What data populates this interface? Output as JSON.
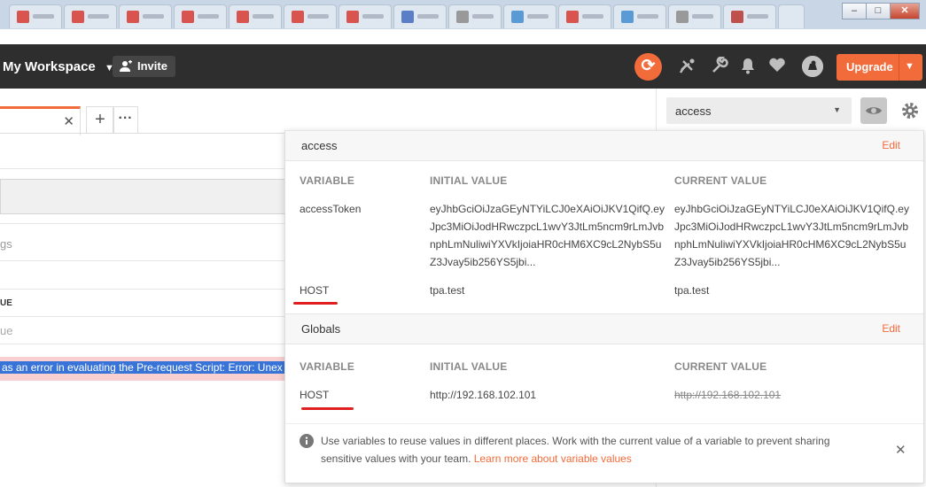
{
  "app": {
    "workspace_label": "My Workspace",
    "invite_label": "Invite",
    "upgrade_label": "Upgrade"
  },
  "environment": {
    "selected": "access"
  },
  "request": {
    "error_text": "as an error in evaluating the Pre-request Script:  Error: Unex",
    "fragment_settings": "gs",
    "fragment_value_header": "UE",
    "fragment_value_placeholder": "ue"
  },
  "popover": {
    "environment_section": {
      "title": "access",
      "edit_label": "Edit",
      "columns": [
        "VARIABLE",
        "INITIAL VALUE",
        "CURRENT VALUE"
      ],
      "rows": [
        {
          "variable": "accessToken",
          "initial": "eyJhbGciOiJzaGEyNTYiLCJ0eXAiOiJKV1QifQ.eyJpc3MiOiJodHRwczpcL1wvY3JtLm5ncm9rLmJvbnphLmNuliwiYXVkIjoiaHR0cHM6XC9cL2NybS5uZ3Jvay5ib256YS5jbi...",
          "current": "eyJhbGciOiJzaGEyNTYiLCJ0eXAiOiJKV1QifQ.eyJpc3MiOiJodHRwczpcL1wvY3JtLm5ncm9rLmJvbnphLmNuliwiYXVkIjoiaHR0cHM6XC9cL2NybS5uZ3Jvay5ib256YS5jbi..."
        },
        {
          "variable": "HOST",
          "initial": "tpa.test",
          "current": "tpa.test"
        }
      ]
    },
    "globals_section": {
      "title": "Globals",
      "edit_label": "Edit",
      "columns": [
        "VARIABLE",
        "INITIAL VALUE",
        "CURRENT VALUE"
      ],
      "rows": [
        {
          "variable": "HOST",
          "initial": "http://192.168.102.101",
          "current": "http://192.168.102.101"
        }
      ]
    },
    "footer": {
      "text": "Use variables to reuse values in different places. Work with the current value of a variable to prevent sharing sensitive values with your team.",
      "link": "Learn more about variable values"
    }
  },
  "colors": {
    "accent": "#f26b3a",
    "header_bg": "#2e2e2e",
    "annotation": "#e02020"
  }
}
